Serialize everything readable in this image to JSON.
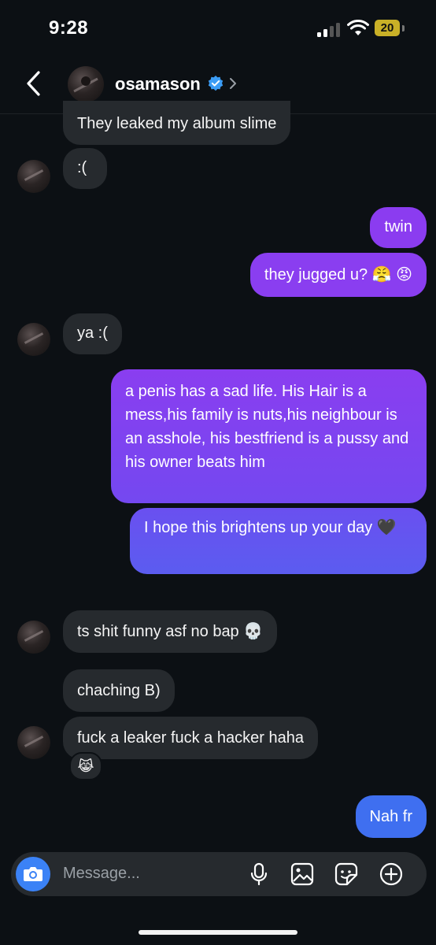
{
  "status_bar": {
    "time": "9:28",
    "battery": "20",
    "battery_color": "#c9b027"
  },
  "header": {
    "username": "osamason",
    "verified": true
  },
  "messages": [
    {
      "from": "them",
      "text": "They leaked my album slime"
    },
    {
      "from": "them",
      "text": ":("
    },
    {
      "from": "me",
      "text": "twin"
    },
    {
      "from": "me",
      "text": "they jugged u? 😤 😡"
    },
    {
      "from": "them",
      "text": "ya :("
    },
    {
      "from": "me",
      "text": "a penis has a sad life. His Hair is a mess,his family is nuts,his neighbour is an asshole, his bestfriend is a pussy and his owner beats him"
    },
    {
      "from": "me",
      "text": "I hope this brightens up your day 🖤"
    },
    {
      "from": "them",
      "text": "ts shit funny asf no bap 💀"
    },
    {
      "from": "them",
      "text": "chaching B)"
    },
    {
      "from": "them",
      "text": "fuck a leaker fuck a hacker haha",
      "reaction": "😹"
    },
    {
      "from": "me",
      "text": "Nah fr"
    }
  ],
  "composer": {
    "placeholder": "Message..."
  },
  "icons": [
    "back-chevron-icon",
    "verified-badge-icon",
    "chevron-right-icon",
    "camera-icon",
    "microphone-icon",
    "gallery-icon",
    "sticker-icon",
    "plus-circle-icon"
  ],
  "colors": {
    "background": "#0c1014",
    "incoming": "#262a2e",
    "outgoing_top": "#8b3cf0",
    "outgoing_bottom": "#5b5cf0",
    "accent_blue": "#3b82f6"
  }
}
